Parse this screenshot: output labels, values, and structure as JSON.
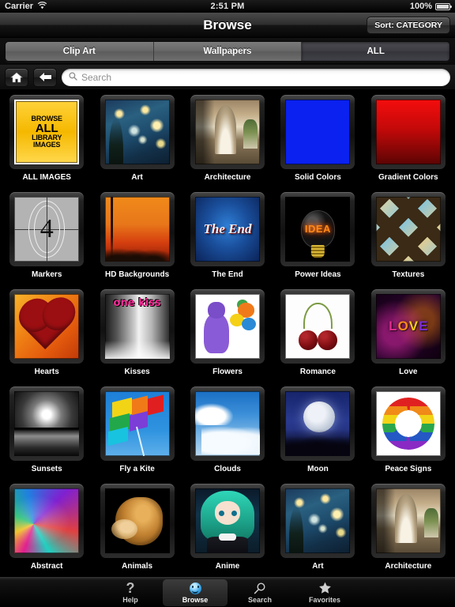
{
  "status_bar": {
    "carrier": "Carrier",
    "wifi_icon": "wifi-icon",
    "time": "2:51  PM",
    "battery_percent": "100%",
    "battery_icon": "battery-full-icon"
  },
  "nav_bar": {
    "title": "Browse",
    "sort_button": "Sort: CATEGORY"
  },
  "segmented_control": {
    "options": [
      {
        "label": "Clip Art",
        "active": false
      },
      {
        "label": "Wallpapers",
        "active": false
      },
      {
        "label": "ALL",
        "active": true
      }
    ]
  },
  "toolbar": {
    "home_icon": "home-icon",
    "back_icon": "back-arrow-icon",
    "search": {
      "icon": "search-icon",
      "placeholder": "Search",
      "value": ""
    }
  },
  "grid": {
    "rows": [
      [
        {
          "caption": "ALL IMAGES",
          "art": "a-allimages",
          "text_lines": [
            "BROWSE",
            "ALL",
            "LIBRARY",
            "IMAGES"
          ]
        },
        {
          "caption": "Art",
          "art": "a-starry"
        },
        {
          "caption": "Architecture",
          "art": "a-arch"
        },
        {
          "caption": "Solid Colors",
          "art": "a-solid",
          "color": "#0a21f0"
        },
        {
          "caption": "Gradient Colors",
          "art": "a-gradient",
          "color": "#f40d0d"
        }
      ],
      [
        {
          "caption": "Markers",
          "art": "a-markers",
          "number": "4"
        },
        {
          "caption": "HD Backgrounds",
          "art": "a-hd"
        },
        {
          "caption": "The End",
          "art": "a-theend",
          "overlay_text": "The End"
        },
        {
          "caption": "Power Ideas",
          "art": "a-idea",
          "overlay_text": "IDEA"
        },
        {
          "caption": "Textures",
          "art": "a-textures"
        }
      ],
      [
        {
          "caption": "Hearts",
          "art": "a-hearts"
        },
        {
          "caption": "Kisses",
          "art": "a-kisses",
          "overlay_text": "one kiss"
        },
        {
          "caption": "Flowers",
          "art": "a-flowers"
        },
        {
          "caption": "Romance",
          "art": "a-romance"
        },
        {
          "caption": "Love",
          "art": "a-love",
          "letters": [
            "L",
            "O",
            "V",
            "E"
          ]
        }
      ],
      [
        {
          "caption": "Sunsets",
          "art": "a-sunsets"
        },
        {
          "caption": "Fly a Kite",
          "art": "a-kite"
        },
        {
          "caption": "Clouds",
          "art": "a-clouds"
        },
        {
          "caption": "Moon",
          "art": "a-moon"
        },
        {
          "caption": "Peace Signs",
          "art": "a-peace"
        }
      ],
      [
        {
          "caption": "Abstract",
          "art": "a-abstract"
        },
        {
          "caption": "Animals",
          "art": "a-animals"
        },
        {
          "caption": "Anime",
          "art": "a-anime"
        },
        {
          "caption": "Art",
          "art": "a-starry"
        },
        {
          "caption": "Architecture",
          "art": "a-arch"
        }
      ]
    ]
  },
  "tab_bar": {
    "items": [
      {
        "label": "Help",
        "icon": "question-mark-icon",
        "active": false
      },
      {
        "label": "Browse",
        "icon": "smiley-face-icon",
        "active": true
      },
      {
        "label": "Search",
        "icon": "magnifier-icon",
        "active": false
      },
      {
        "label": "Favorites",
        "icon": "star-icon",
        "active": false
      }
    ]
  },
  "colors": {
    "background": "#000000",
    "accent_yellow": "#f5b800",
    "text": "#ffffff"
  }
}
